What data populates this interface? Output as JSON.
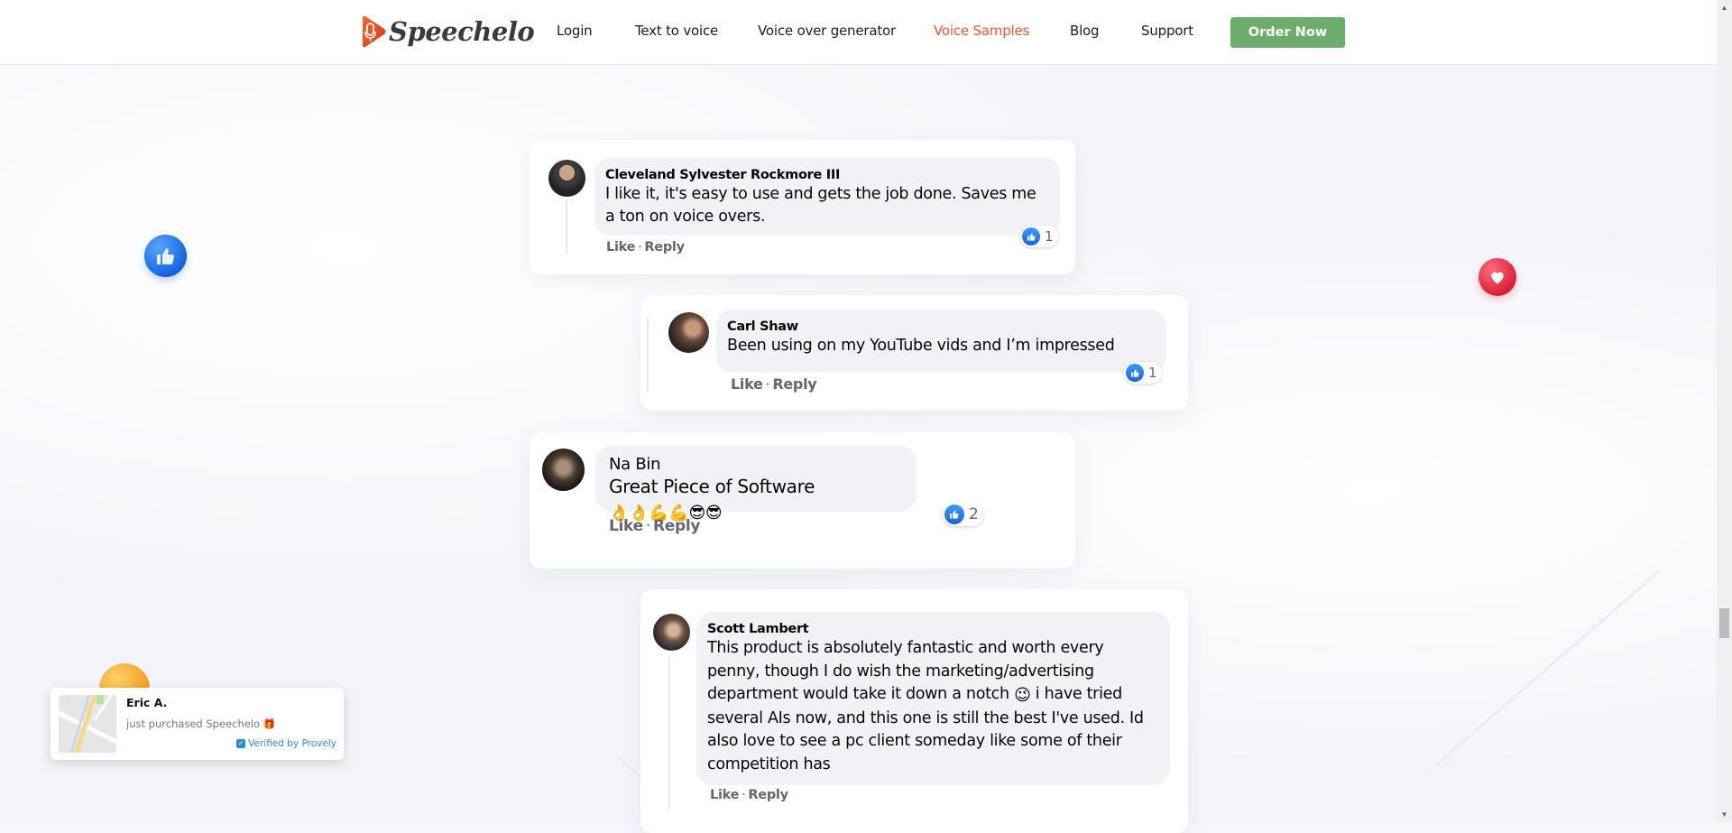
{
  "header": {
    "logo_text": "Speechelo",
    "nav": [
      {
        "label": "Login",
        "active": false
      },
      {
        "label": "Text to voice",
        "active": false
      },
      {
        "label": "Voice over generator",
        "active": false
      },
      {
        "label": "Voice Samples",
        "active": true
      },
      {
        "label": "Blog",
        "active": false
      },
      {
        "label": "Support",
        "active": false
      }
    ],
    "cta_label": "Order Now"
  },
  "colors": {
    "accent_nav": "#e5582e",
    "cta": "#6cad6c",
    "like_blue": "#1877f2",
    "heart_red": "#d8203a"
  },
  "comments": [
    {
      "author": "Cleveland Sylvester Rockmore III",
      "text": "I like it, it's easy to use and gets the job done. Saves me a ton on voice overs.",
      "like_label": "Like",
      "reply_label": "Reply",
      "separator": "·",
      "reaction_count": "1"
    },
    {
      "author": "Carl Shaw",
      "text": "Been using on my YouTube vids and I’m impressed",
      "like_label": "Like",
      "reply_label": "Reply",
      "separator": "·",
      "reaction_count": "1"
    },
    {
      "author": "Na Bin",
      "text": "Great Piece of Software",
      "emojis": "👌👌💪💪😎😎",
      "like_label": "Like",
      "reply_label": "Reply",
      "separator": "·",
      "reaction_count": "2"
    },
    {
      "author": "Scott Lambert",
      "text_before_emoji": "This product is absolutely fantastic and worth every penny, though I do wish the marketing/advertising department would take it down a notch",
      "emoji": "😉",
      "text_after_emoji": "i have tried several AIs now, and this one is still the best I've used. Id also love to see a pc client someday like some of their competition has",
      "like_label": "Like",
      "reply_label": "Reply",
      "separator": "·"
    }
  ],
  "popup": {
    "name": "Eric A.",
    "message": "just purchased Speechelo",
    "emoji": "🎁",
    "verified_label": "Verified by Provely"
  },
  "decorations": {
    "floating_icons": [
      "like-icon",
      "heart-icon",
      "orange-badge-icon"
    ]
  }
}
